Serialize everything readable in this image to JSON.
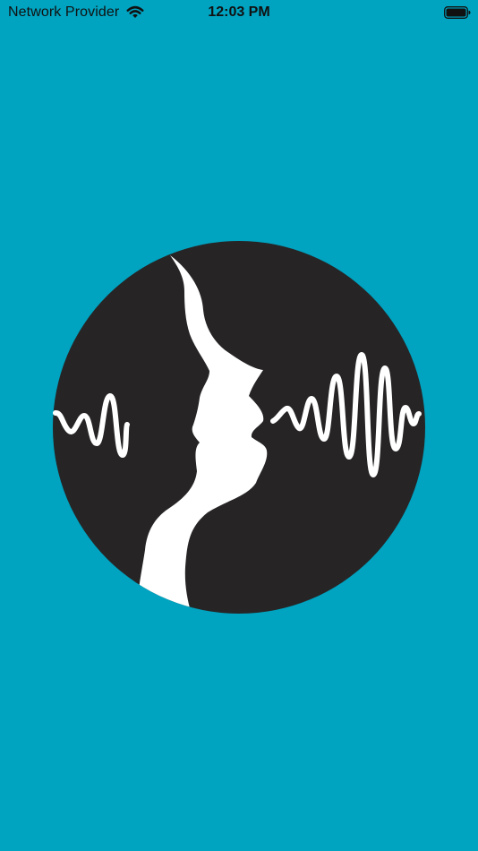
{
  "status_bar": {
    "carrier": "Network Provider",
    "time": "12:03 PM",
    "wifi_icon": "wifi-icon",
    "battery_icon": "battery-icon"
  },
  "splash": {
    "background_color": "#00a3c0",
    "logo_icon": "voice-profile-soundwave-logo",
    "logo_color": "#262425",
    "logo_mark_color": "#ffffff"
  }
}
